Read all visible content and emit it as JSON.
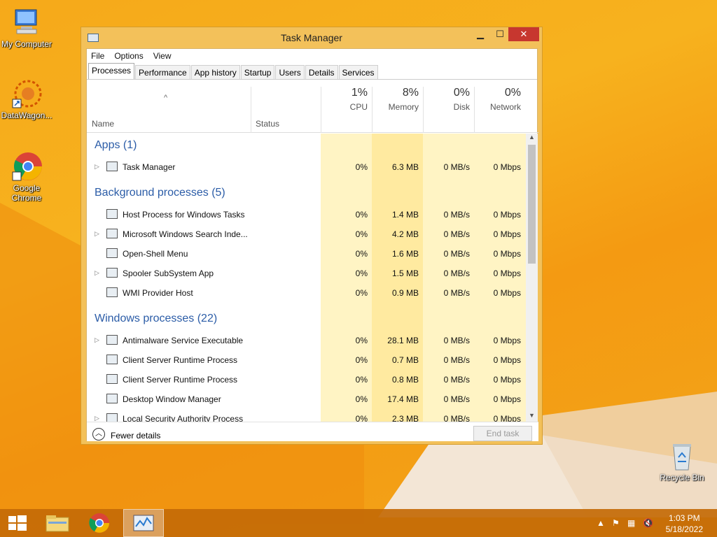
{
  "desktop": {
    "icons": [
      {
        "label": "My Computer"
      },
      {
        "label": "DataWagon..."
      },
      {
        "label": "Google Chrome"
      },
      {
        "label": "Recycle Bin"
      }
    ]
  },
  "window": {
    "title": "Task Manager",
    "controls": {
      "minimize": "▁",
      "maximize": "☐",
      "close": "✕"
    },
    "menu": [
      "File",
      "Options",
      "View"
    ],
    "tabs": [
      "Processes",
      "Performance",
      "App history",
      "Startup",
      "Users",
      "Details",
      "Services"
    ],
    "active_tab": "Processes",
    "columns": {
      "name": "Name",
      "status": "Status",
      "cpu": {
        "pct": "1%",
        "label": "CPU"
      },
      "memory": {
        "pct": "8%",
        "label": "Memory"
      },
      "disk": {
        "pct": "0%",
        "label": "Disk"
      },
      "network": {
        "pct": "0%",
        "label": "Network"
      }
    },
    "groups": [
      {
        "title": "Apps (1)",
        "rows": [
          {
            "name": "Task Manager",
            "expand": true,
            "cpu": "0%",
            "memory": "6.3 MB",
            "disk": "0 MB/s",
            "network": "0 Mbps"
          }
        ]
      },
      {
        "title": "Background processes (5)",
        "rows": [
          {
            "name": "Host Process for Windows Tasks",
            "expand": false,
            "cpu": "0%",
            "memory": "1.4 MB",
            "disk": "0 MB/s",
            "network": "0 Mbps"
          },
          {
            "name": "Microsoft Windows Search Inde...",
            "expand": true,
            "cpu": "0%",
            "memory": "4.2 MB",
            "disk": "0 MB/s",
            "network": "0 Mbps"
          },
          {
            "name": "Open-Shell Menu",
            "expand": false,
            "cpu": "0%",
            "memory": "1.6 MB",
            "disk": "0 MB/s",
            "network": "0 Mbps"
          },
          {
            "name": "Spooler SubSystem App",
            "expand": true,
            "cpu": "0%",
            "memory": "1.5 MB",
            "disk": "0 MB/s",
            "network": "0 Mbps"
          },
          {
            "name": "WMI Provider Host",
            "expand": false,
            "cpu": "0%",
            "memory": "0.9 MB",
            "disk": "0 MB/s",
            "network": "0 Mbps"
          }
        ]
      },
      {
        "title": "Windows processes (22)",
        "rows": [
          {
            "name": "Antimalware Service Executable",
            "expand": true,
            "cpu": "0%",
            "memory": "28.1 MB",
            "disk": "0 MB/s",
            "network": "0 Mbps"
          },
          {
            "name": "Client Server Runtime Process",
            "expand": false,
            "cpu": "0%",
            "memory": "0.7 MB",
            "disk": "0 MB/s",
            "network": "0 Mbps"
          },
          {
            "name": "Client Server Runtime Process",
            "expand": false,
            "cpu": "0%",
            "memory": "0.8 MB",
            "disk": "0 MB/s",
            "network": "0 Mbps"
          },
          {
            "name": "Desktop Window Manager",
            "expand": false,
            "cpu": "0%",
            "memory": "17.4 MB",
            "disk": "0 MB/s",
            "network": "0 Mbps"
          },
          {
            "name": "Local Security Authority Process",
            "expand": true,
            "cpu": "0%",
            "memory": "2.3 MB",
            "disk": "0 MB/s",
            "network": "0 Mbps"
          }
        ]
      }
    ],
    "footer": {
      "fewer_details": "Fewer details",
      "end_task": "End task"
    }
  },
  "taskbar": {
    "clock_time": "1:03 PM",
    "clock_date": "5/18/2022"
  },
  "colors": {
    "window_frame": "#f3c15a",
    "close_button": "#c7372f",
    "group_title": "#2b5ca7",
    "heat_light": "#fff4c4",
    "heat_medium": "#ffeaa0",
    "taskbar": "#c46a06"
  }
}
